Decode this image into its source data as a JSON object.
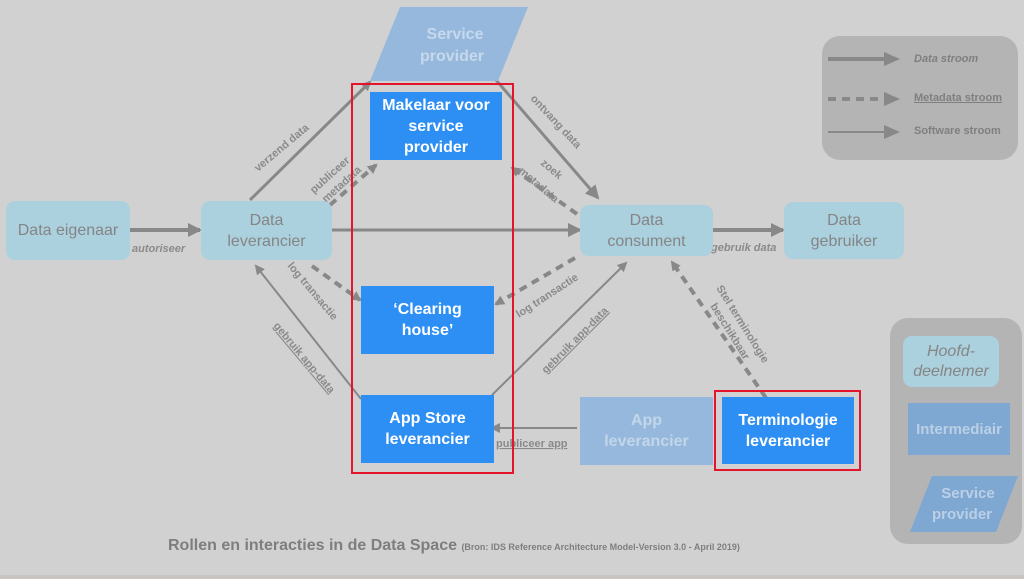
{
  "title": "Rollen en interacties in de Data Space",
  "source": "(Bron: IDS Reference Architecture Model-Version 3.0 - April 2019)",
  "nodes": {
    "service_provider": "Service\nprovider",
    "makelaar": "Makelaar voor service provider",
    "data_eigenaar": "Data eigenaar",
    "data_leverancier": "Data leverancier",
    "data_consument": "Data consument",
    "data_gebruiker": "Data gebruiker",
    "clearing_house": "‘Clearing house’",
    "app_store": "App Store leverancier",
    "app_leverancier": "App leverancier",
    "terminologie": "Terminologie leverancier"
  },
  "edges": {
    "verzend_data": "verzend data",
    "publiceer_metadata_1": "publiceer",
    "publiceer_metadata_2": "metadata",
    "ontvang_data": "ontvang data",
    "zoek_metadata_1": "zoek",
    "zoek_metadata_2": "metadata",
    "autoriseer": "autoriseer",
    "gebruik_data": "gebruik data",
    "log_transactie_left": "log transactie",
    "log_transactie_right": "log transactie",
    "gebruik_app_data_left": "gebruik app-data",
    "gebruik_app_data_right": "gebruik app-data",
    "publiceer_app": "publiceer app",
    "stel_terminologie_1": "Stel terminologie",
    "stel_terminologie_2": "beschikbaar"
  },
  "legend": {
    "data_stroom": "Data stroom",
    "metadata_stroom": "Metadata stroom",
    "software_stroom": "Software stroom"
  },
  "legend_roles": {
    "hoofddeelnemer": "Hoofd-\ndeelnemer",
    "intermediair": "Intermediair",
    "service_provider": "Service\nprovider"
  },
  "colors": {
    "main_participant": "#abd0de",
    "intermediary": "#2d8ff3",
    "service_provider": "#96b8dd",
    "highlight": "#e5142d",
    "arrow": "#888888"
  }
}
